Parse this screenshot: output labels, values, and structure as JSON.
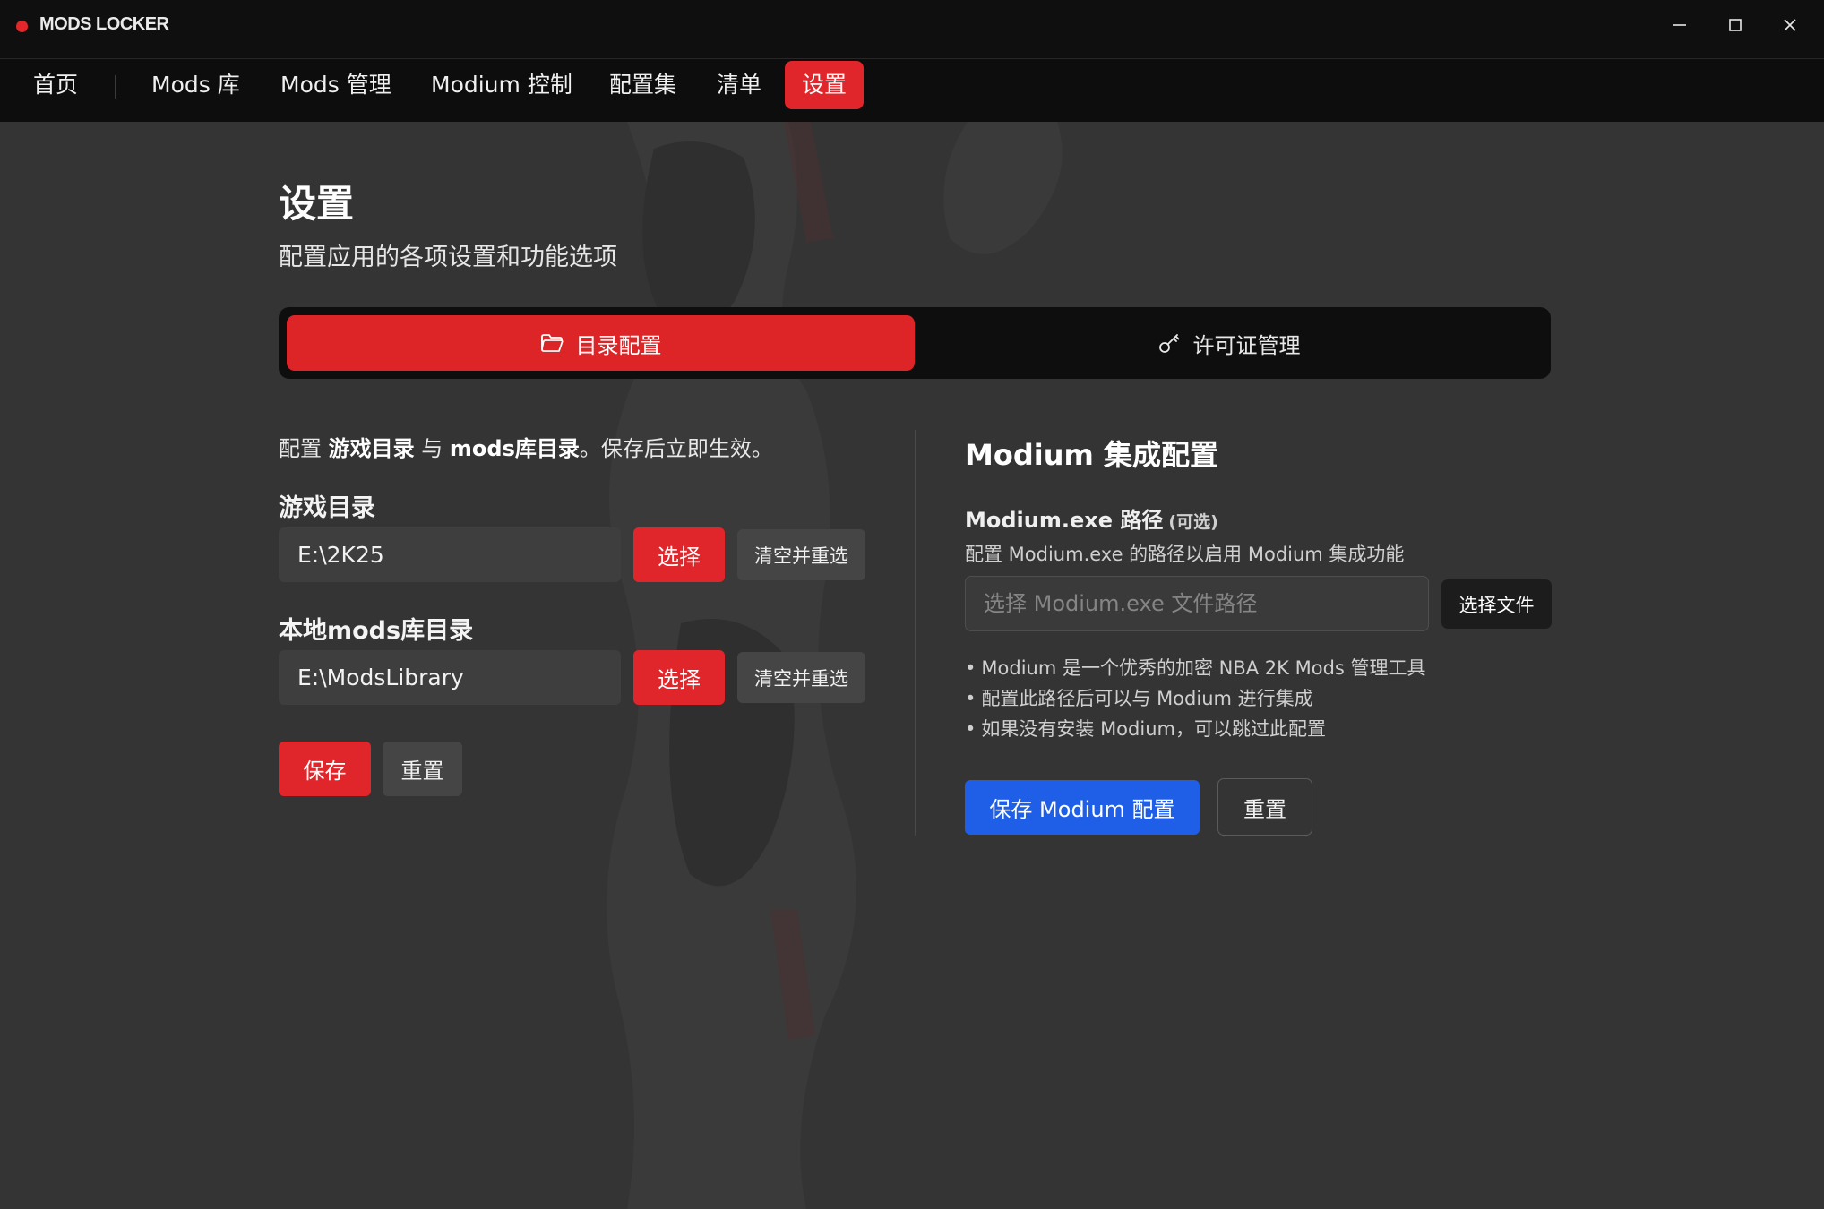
{
  "app": {
    "title": "MODS LOCKER",
    "dot_color": "#e3262a"
  },
  "window_controls": {
    "minimize": "minimize-icon",
    "maximize": "maximize-icon",
    "close": "close-icon"
  },
  "nav": {
    "items": [
      "首页",
      "Mods 库",
      "Mods 管理",
      "Modium 控制",
      "配置集",
      "清单"
    ],
    "active": "设置"
  },
  "page": {
    "title": "设置",
    "subtitle": "配置应用的各项设置和功能选项"
  },
  "tabs": {
    "directory": {
      "label": "目录配置",
      "icon": "folder-icon"
    },
    "license": {
      "label": "许可证管理",
      "icon": "key-icon"
    }
  },
  "directory_config": {
    "intro": {
      "prefix": "配置 ",
      "game_dir": "游戏目录",
      "with": " 与 ",
      "mods_dir": "mods库目录",
      "suffix": "。保存后立即生效。"
    },
    "game_dir": {
      "label": "游戏目录",
      "value": "E:\\2K25",
      "select_label": "选择",
      "clear_label": "清空并重选"
    },
    "mods_dir": {
      "label": "本地mods库目录",
      "value": "E:\\ModsLibrary",
      "select_label": "选择",
      "clear_label": "清空并重选"
    },
    "save_label": "保存",
    "reset_label": "重置"
  },
  "modium": {
    "title": "Modium 集成配置",
    "path_label": "Modium.exe 路径",
    "optional_label": "(可选)",
    "hint": "配置 Modium.exe 的路径以启用 Modium 集成功能",
    "path_placeholder": "选择 Modium.exe 文件路径",
    "select_file_label": "选择文件",
    "notes": [
      "Modium 是一个优秀的加密 NBA 2K Mods 管理工具",
      "配置此路径后可以与 Modium 进行集成",
      "如果没有安装 Modium，可以跳过此配置"
    ],
    "save_label": "保存 Modium 配置",
    "reset_label": "重置"
  },
  "colors": {
    "accent_red": "#e0262a",
    "accent_blue": "#1f5fe8",
    "background": "#343434"
  }
}
